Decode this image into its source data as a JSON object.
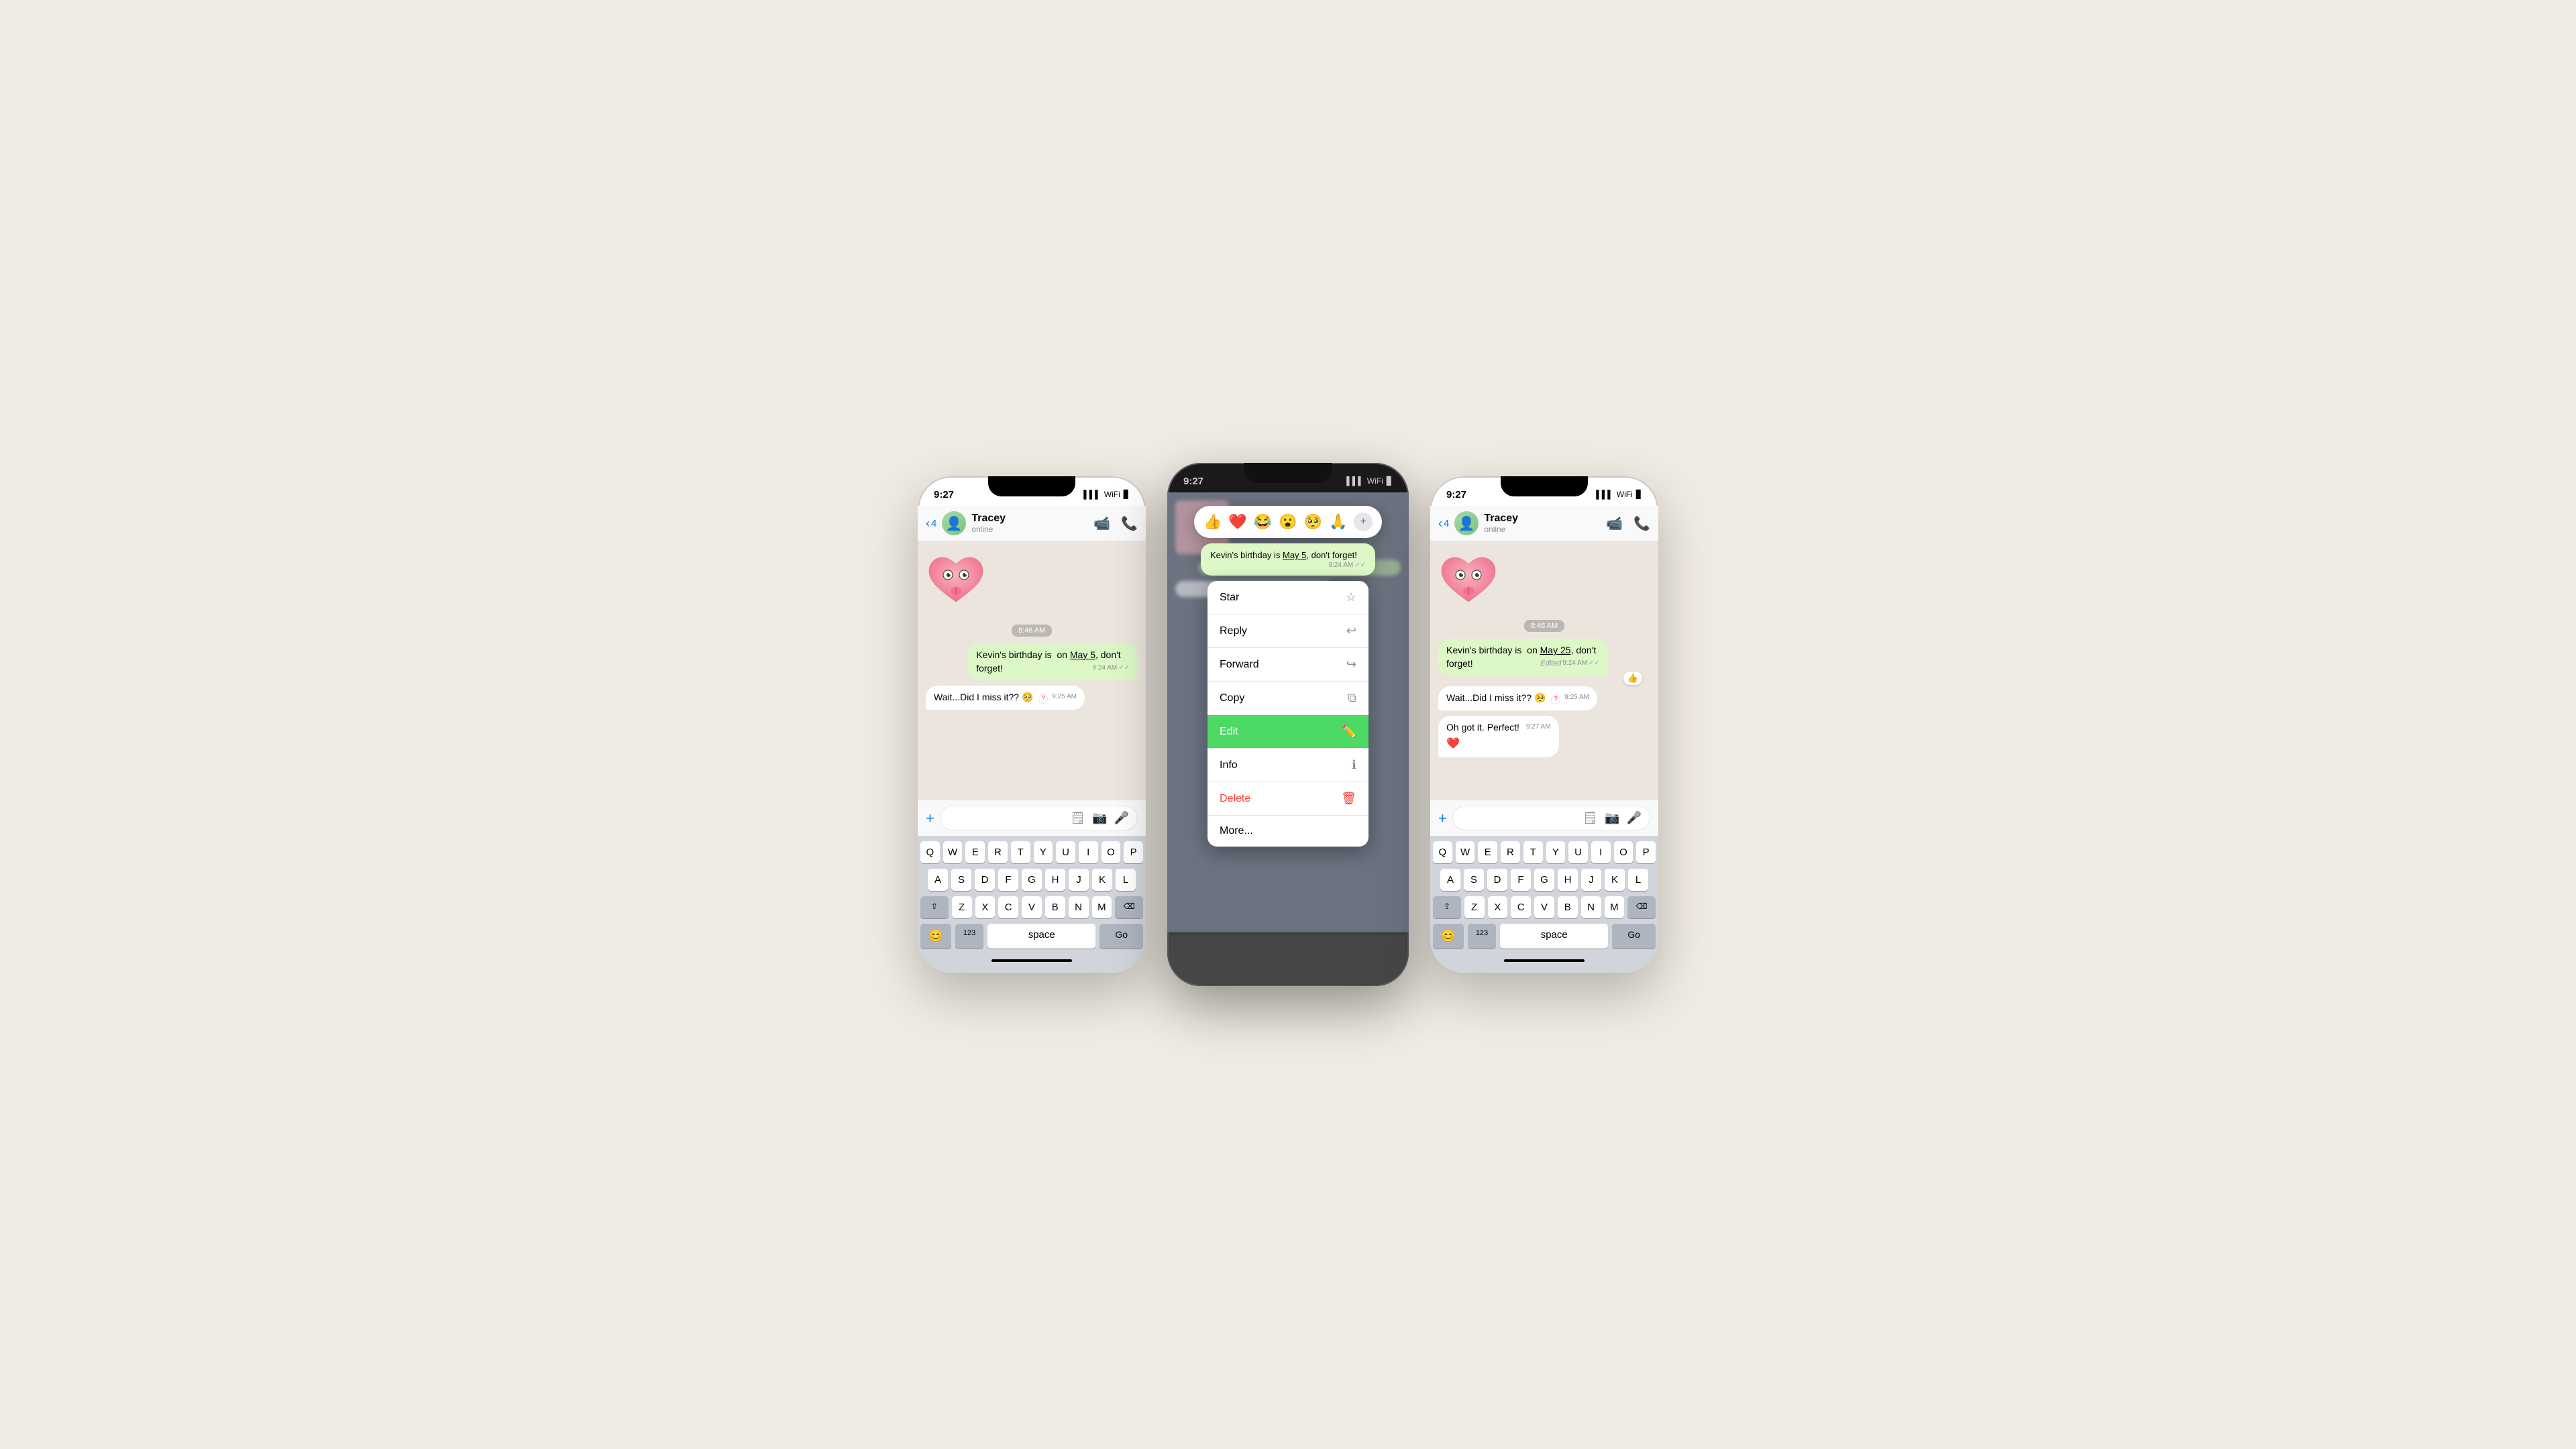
{
  "background_color": "#f0ebe3",
  "phones": [
    {
      "id": "phone-left",
      "type": "light",
      "status": {
        "time": "9:27",
        "signal": "▌▌▌",
        "wifi": "WiFi",
        "battery": "🔋"
      },
      "header": {
        "back_count": "4",
        "contact_name": "Tracey",
        "contact_status": "online",
        "video_icon": "📹",
        "phone_icon": "📞"
      },
      "messages": [
        {
          "type": "sticker",
          "content": "🫀"
        },
        {
          "type": "time_badge",
          "content": "8:46 AM"
        },
        {
          "type": "sent",
          "text": "Kevin's birthday is  on May 5, don't forget!",
          "time": "9:24 AM",
          "has_check": true
        },
        {
          "type": "received",
          "text": "Wait...Did I miss it?? 🥺",
          "time": "9:25 AM",
          "has_question": true
        }
      ],
      "keyboard": {
        "rows": [
          [
            "Q",
            "W",
            "E",
            "R",
            "T",
            "Y",
            "U",
            "I",
            "O",
            "P"
          ],
          [
            "A",
            "S",
            "D",
            "F",
            "G",
            "H",
            "J",
            "K",
            "L"
          ],
          [
            "⇧",
            "Z",
            "X",
            "C",
            "V",
            "B",
            "N",
            "M",
            "⌫"
          ],
          [
            "123",
            "space",
            "Go"
          ]
        ],
        "emoji_key": "😊",
        "mic_key": "🎤"
      }
    },
    {
      "id": "phone-middle",
      "type": "dark",
      "status": {
        "time": "9:27",
        "signal": "▌▌▌",
        "wifi": "WiFi",
        "battery": "🔋"
      },
      "emoji_reactions": [
        "👍",
        "❤️",
        "😂",
        "😮",
        "🥺",
        "🙏"
      ],
      "context_message": {
        "text": "Kevin's birthday is May 5, don't forget!",
        "time": "9:24 AM"
      },
      "context_menu_items": [
        {
          "label": "Star",
          "icon": "☆",
          "active": false
        },
        {
          "label": "Reply",
          "icon": "↩",
          "active": false
        },
        {
          "label": "Forward",
          "icon": "↪",
          "active": false
        },
        {
          "label": "Copy",
          "icon": "⧉",
          "active": false
        },
        {
          "label": "Edit",
          "icon": "✏️",
          "active": true
        },
        {
          "label": "Info",
          "icon": "ℹ",
          "active": false
        },
        {
          "label": "Delete",
          "icon": "🗑",
          "active": false,
          "is_delete": true
        },
        {
          "label": "More...",
          "icon": "",
          "active": false
        }
      ]
    },
    {
      "id": "phone-right",
      "type": "light",
      "status": {
        "time": "9:27",
        "signal": "▌▌▌",
        "wifi": "WiFi",
        "battery": "🔋"
      },
      "header": {
        "back_count": "4",
        "contact_name": "Tracey",
        "contact_status": "online",
        "video_icon": "📹",
        "phone_icon": "📞"
      },
      "messages": [
        {
          "type": "sticker",
          "content": "🫀"
        },
        {
          "type": "time_badge",
          "content": "8:46 AM"
        },
        {
          "type": "sent",
          "text": "Kevin's birthday is  on May 25, don't forget!",
          "time": "9:24 AM",
          "edited": true,
          "has_check": true,
          "reaction": "👍"
        },
        {
          "type": "received",
          "text": "Wait...Did I miss it?? 🥺",
          "time": "9:25 AM",
          "has_question": true
        },
        {
          "type": "received",
          "text": "Oh got it. Perfect! ",
          "time": "9:27 AM",
          "has_heart": true
        }
      ],
      "keyboard": {
        "rows": [
          [
            "Q",
            "W",
            "E",
            "R",
            "T",
            "Y",
            "U",
            "I",
            "O",
            "P"
          ],
          [
            "A",
            "S",
            "D",
            "F",
            "G",
            "H",
            "J",
            "K",
            "L"
          ],
          [
            "⇧",
            "Z",
            "X",
            "C",
            "V",
            "B",
            "N",
            "M",
            "⌫"
          ],
          [
            "123",
            "space",
            "Go"
          ]
        ],
        "emoji_key": "😊",
        "mic_key": "🎤"
      }
    }
  ],
  "context_menu": {
    "star_label": "Star",
    "reply_label": "Reply",
    "forward_label": "Forward",
    "copy_label": "Copy",
    "edit_label": "Edit",
    "info_label": "Info",
    "delete_label": "Delete",
    "more_label": "More..."
  }
}
